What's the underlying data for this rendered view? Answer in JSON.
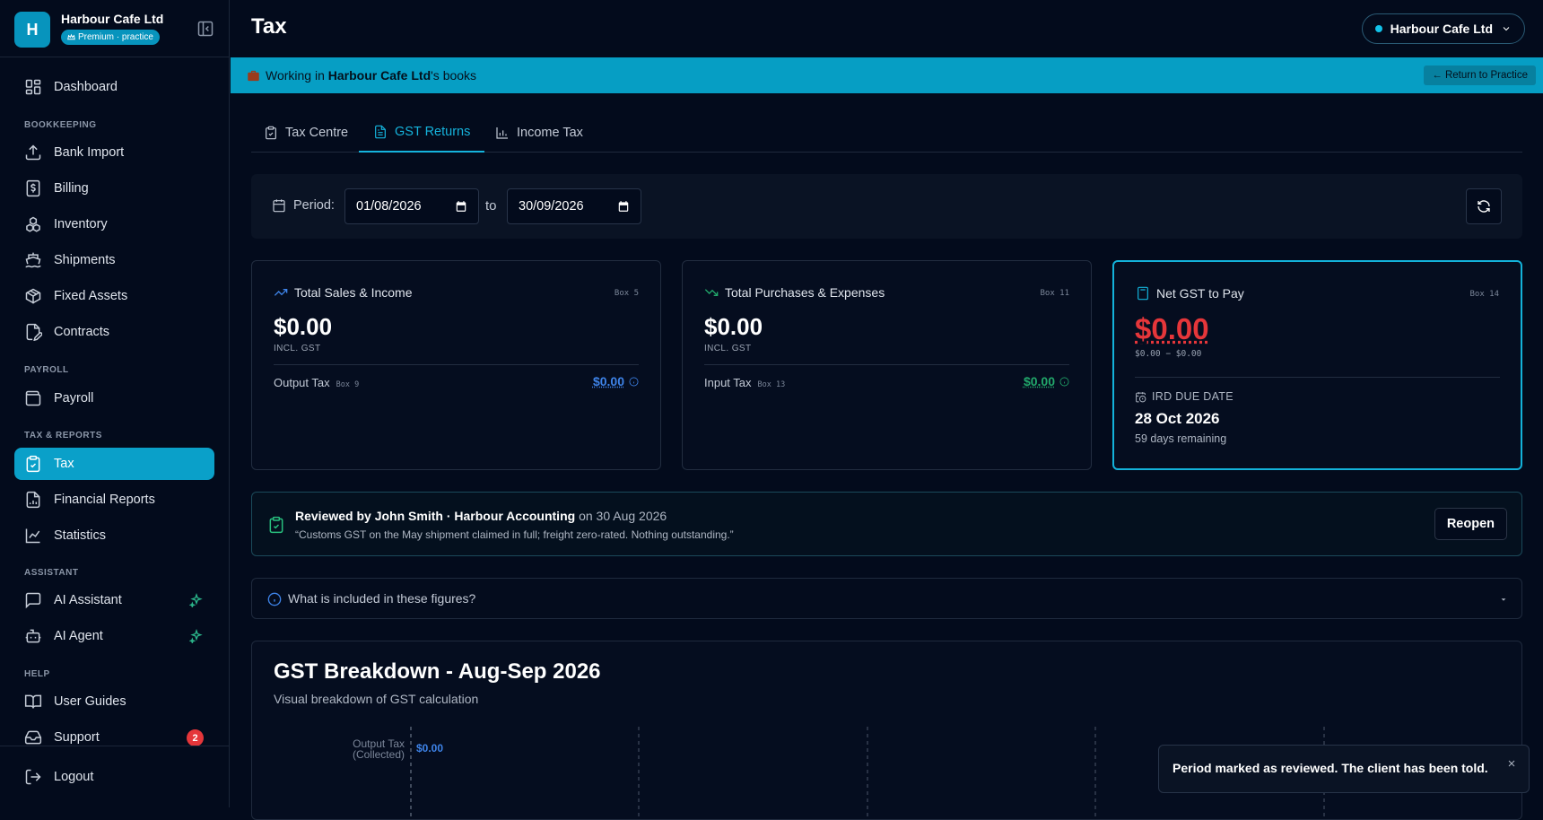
{
  "app": {
    "org_name": "Harbour Cafe Ltd",
    "plan_badge": "Premium · practice",
    "logo_letter": "H",
    "accent_color": "#0aa0c9"
  },
  "sidebar": {
    "dashboard": "Dashboard",
    "sections": {
      "bookkeeping": "BOOKKEEPING",
      "payroll": "PAYROLL",
      "tax_reports": "TAX & REPORTS",
      "assistant": "ASSISTANT",
      "help": "HELP"
    },
    "items": {
      "bank_import": "Bank Import",
      "billing": "Billing",
      "inventory": "Inventory",
      "shipments": "Shipments",
      "fixed_assets": "Fixed Assets",
      "contracts": "Contracts",
      "payroll": "Payroll",
      "tax": "Tax",
      "financial_reports": "Financial Reports",
      "statistics": "Statistics",
      "ai_assistant": "AI Assistant",
      "ai_agent": "AI Agent",
      "user_guides": "User Guides",
      "support": "Support",
      "logout": "Logout"
    },
    "support_badge": "2",
    "active_item": "Tax"
  },
  "header": {
    "title": "Tax",
    "org_switcher": "Harbour Cafe Ltd"
  },
  "banner": {
    "prefix": "Working in",
    "org": "Harbour Cafe Ltd",
    "suffix": "'s books",
    "return_button": "← Return to Practice"
  },
  "tabs": [
    {
      "label": "Tax Centre",
      "icon": "clipboard-check-icon"
    },
    {
      "label": "GST Returns",
      "icon": "file-text-icon",
      "active": true
    },
    {
      "label": "Income Tax",
      "icon": "bar-chart-icon"
    }
  ],
  "period": {
    "label": "Period:",
    "from": "01/08/2026",
    "to_label": "to",
    "to": "30/09/2026"
  },
  "cards": {
    "sales": {
      "title": "Total Sales & Income",
      "box": "Box 5",
      "amount": "$0.00",
      "sub": "INCL. GST",
      "row_label": "Output Tax",
      "row_box": "Box 9",
      "row_value": "$0.00",
      "color": "#3e83e8"
    },
    "purchases": {
      "title": "Total Purchases & Expenses",
      "box": "Box 11",
      "amount": "$0.00",
      "sub": "INCL. GST",
      "row_label": "Input Tax",
      "row_box": "Box 13",
      "row_value": "$0.00",
      "color": "#22a86b"
    },
    "net": {
      "title": "Net GST to Pay",
      "box": "Box 14",
      "amount": "$0.00",
      "calc": "$0.00 − $0.00",
      "due_label": "IRD DUE DATE",
      "due_date": "28 Oct 2026",
      "remaining": "59 days remaining",
      "color": "#e5363a"
    }
  },
  "review": {
    "reviewer": "Reviewed by John Smith · Harbour Accounting",
    "on": "on 30 Aug 2026",
    "note": "“Customs GST on the May shipment claimed in full; freight zero-rated. Nothing outstanding.”",
    "reopen": "Reopen"
  },
  "faq": {
    "question": "What is included in these figures?"
  },
  "chart_data": {
    "type": "bar",
    "title": "GST Breakdown - Aug-Sep 2026",
    "subtitle": "Visual breakdown of GST calculation",
    "categories": [
      "Output Tax (Collected)"
    ],
    "values": [
      0
    ],
    "value_labels": [
      "$0.00"
    ],
    "orientation": "horizontal",
    "grid": true,
    "series_color": "#3e83e8"
  },
  "toast": {
    "message": "Period marked as reviewed. The client has been told."
  }
}
